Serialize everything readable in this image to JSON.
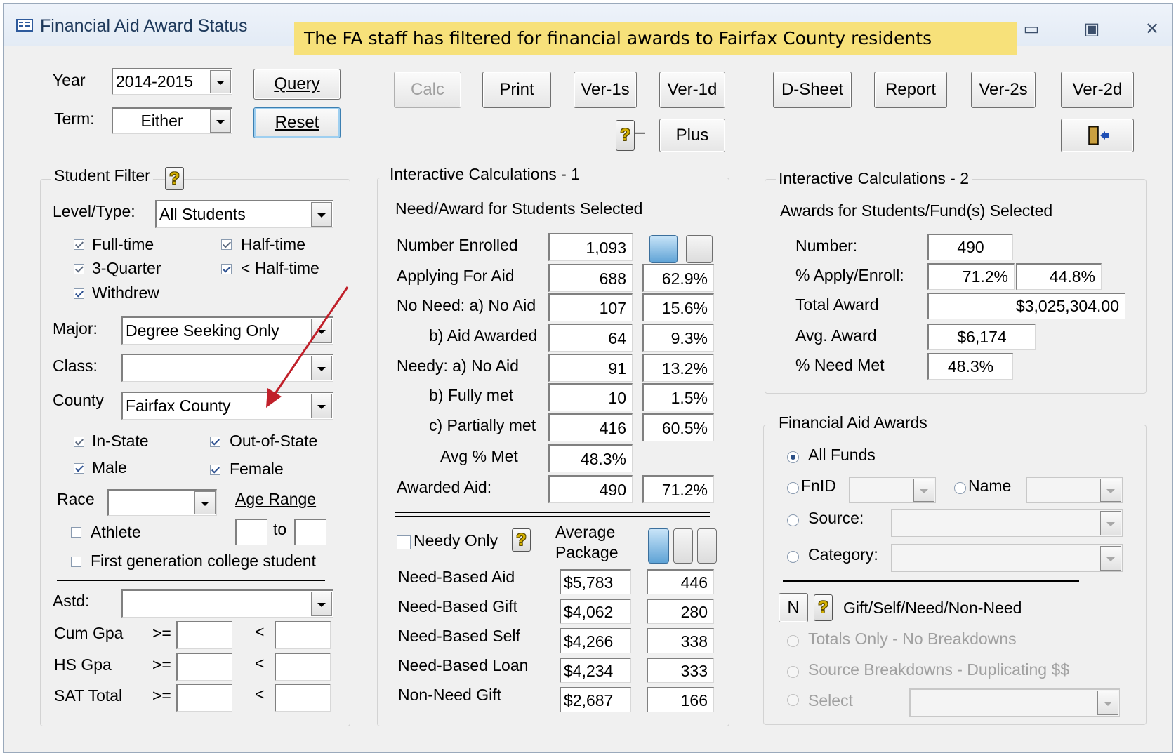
{
  "window": {
    "title": "Financial Aid Award Status",
    "annotation": "The FA staff has filtered for financial awards to Fairfax County residents"
  },
  "top": {
    "year_label": "Year",
    "year_value": "2014-2015",
    "term_label": "Term:",
    "term_value": "Either",
    "query_label": "Query",
    "reset_label": "Reset",
    "calc_label": "Calc",
    "print_label": "Print",
    "ver1s_label": "Ver-1s",
    "ver1d_label": "Ver-1d",
    "dsheet_label": "D-Sheet",
    "report_label": "Report",
    "ver2s_label": "Ver-2s",
    "ver2d_label": "Ver-2d",
    "plus_label": "Plus",
    "dash": "–"
  },
  "filter": {
    "title": "Student Filter",
    "level_label": "Level/Type:",
    "level_value": "All Students",
    "fulltime": "Full-time",
    "halftime": "Half-time",
    "threequarter": "3-Quarter",
    "lthalftime": "< Half-time",
    "withdrew": "Withdrew",
    "major_label": "Major:",
    "major_value": "Degree Seeking Only",
    "class_label": "Class:",
    "class_value": "",
    "county_label": "County",
    "county_value": "Fairfax County",
    "instate": "In-State",
    "outofstate": "Out-of-State",
    "male": "Male",
    "female": "Female",
    "race_label": "Race",
    "age_range_label": "Age Range",
    "age_to": "to",
    "athlete": "Athlete",
    "firstgen": "First generation college student",
    "astd_label": "Astd:",
    "cumgpa_label": "Cum Gpa",
    "hsgpa_label": "HS Gpa",
    "sat_label": "SAT Total",
    "gte": ">=",
    "lt": "<"
  },
  "calc1": {
    "title": "Interactive Calculations - 1",
    "subtitle": "Need/Award for Students Selected",
    "rows": [
      {
        "label": "Number Enrolled",
        "value": "1,093",
        "pct": ""
      },
      {
        "label": "Applying For Aid",
        "value": "688",
        "pct": "62.9%"
      },
      {
        "label": "No Need:  a) No Aid",
        "value": "107",
        "pct": "15.6%"
      },
      {
        "label": "b) Aid Awarded",
        "value": "64",
        "pct": "9.3%"
      },
      {
        "label": "Needy:   a) No Aid",
        "value": "91",
        "pct": "13.2%"
      },
      {
        "label": "b) Fully met",
        "value": "10",
        "pct": "1.5%"
      },
      {
        "label": "c) Partially met",
        "value": "416",
        "pct": "60.5%"
      },
      {
        "label": "Avg % Met",
        "value": "48.3%",
        "pct": ""
      },
      {
        "label": "Awarded Aid:",
        "value": "490",
        "pct": "71.2%"
      }
    ],
    "needy_only_label": "Needy Only",
    "avg_package_label_1": "Average",
    "avg_package_label_2": "Package",
    "packages": [
      {
        "label": "Need-Based Aid",
        "avg": "$5,783",
        "count": "446"
      },
      {
        "label": "Need-Based Gift",
        "avg": "$4,062",
        "count": "280"
      },
      {
        "label": "Need-Based Self",
        "avg": "$4,266",
        "count": "338"
      },
      {
        "label": "Need-Based Loan",
        "avg": "$4,234",
        "count": "333"
      },
      {
        "label": "Non-Need Gift",
        "avg": "$2,687",
        "count": "166"
      }
    ]
  },
  "calc2": {
    "title": "Interactive Calculations - 2",
    "subtitle": "Awards for Students/Fund(s) Selected",
    "number_label": "Number:",
    "number_value": "490",
    "apply_label": "% Apply/Enroll:",
    "apply_value_1": "71.2%",
    "apply_value_2": "44.8%",
    "total_label": "Total Award",
    "total_value": "$3,025,304.00",
    "avg_label": "Avg. Award",
    "avg_value": "$6,174",
    "needmet_label": "% Need Met",
    "needmet_value": "48.3%"
  },
  "awards": {
    "title": "Financial Aid Awards",
    "all_funds": "All Funds",
    "fnid": "FnID",
    "name": "Name",
    "source": "Source:",
    "category": "Category:",
    "n_button": "N",
    "gsn_label": "Gift/Self/Need/Non-Need",
    "totals_only": "Totals Only - No Breakdowns",
    "source_breakdowns": "Source Breakdowns - Duplicating $$",
    "select": "Select"
  }
}
